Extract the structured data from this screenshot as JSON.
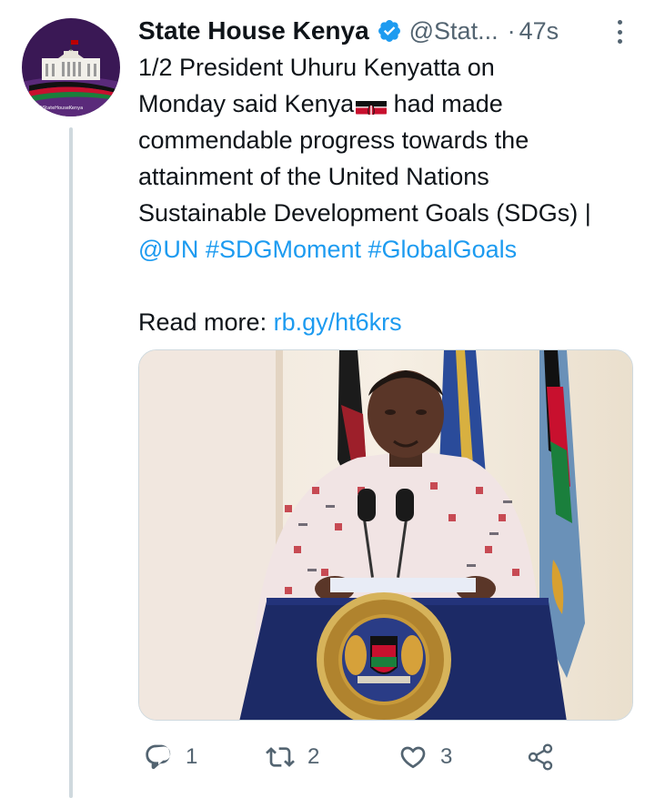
{
  "author": {
    "display_name": "State House Kenya",
    "handle": "@Stat...",
    "separator": "·",
    "timestamp": "47s",
    "avatar_caption": "@StateHouseKenya"
  },
  "tweet": {
    "lines": [
      "1/2 President Uhuru Kenyatta on",
      "Monday said Kenya",
      " had made",
      "commendable progress towards the",
      "attainment of the United Nations",
      "Sustainable Development Goals (SDGs) |"
    ],
    "mention": "@UN",
    "hashtags": [
      "#SDGMoment",
      "#GlobalGoals"
    ],
    "read_more_label": "Read more:",
    "read_more_link": "rb.gy/ht6krs"
  },
  "media": {
    "seal_text": "PRESIDENT · REPUBLIC OF KENYA"
  },
  "actions": {
    "reply_count": "1",
    "retweet_count": "2",
    "like_count": "3"
  },
  "colors": {
    "link": "#1d9bf0",
    "secondary_text": "#536471",
    "verified": "#1d9bf0",
    "thread_line": "#cfd9de"
  }
}
